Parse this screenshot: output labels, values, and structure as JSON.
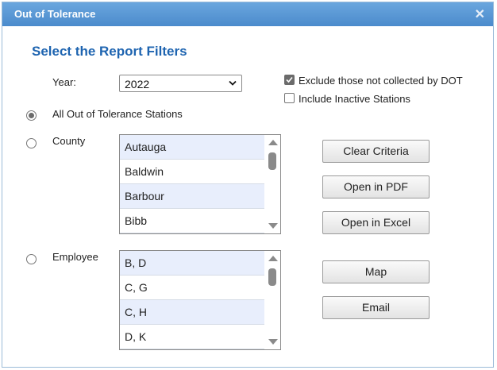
{
  "dialog": {
    "title": "Out of Tolerance",
    "close_glyph": "✕"
  },
  "heading": "Select the Report Filters",
  "year": {
    "label": "Year:",
    "value": "2022"
  },
  "options": {
    "exclude_dot": {
      "label": "Exclude those not collected by DOT",
      "checked": true
    },
    "include_inactive": {
      "label": "Include Inactive Stations",
      "checked": false
    }
  },
  "filters": {
    "all": {
      "label": "All Out of Tolerance Stations",
      "selected": true
    },
    "county": {
      "label": "County",
      "selected": false
    },
    "employee": {
      "label": "Employee",
      "selected": false
    }
  },
  "county_list": [
    "Autauga",
    "Baldwin",
    "Barbour",
    "Bibb"
  ],
  "employee_list": [
    "B, D",
    "C, G",
    "C, H",
    "D, K"
  ],
  "buttons": {
    "clear": "Clear Criteria",
    "pdf": "Open in PDF",
    "excel": "Open in Excel",
    "map": "Map",
    "email": "Email"
  },
  "colors": {
    "title_bar": "#5a97d6",
    "heading": "#1e64b0",
    "row_alt": "#e8eefc"
  },
  "icons": {
    "close": "close-icon",
    "dropdown": "chevron-down-icon",
    "check": "checkmark-icon"
  }
}
